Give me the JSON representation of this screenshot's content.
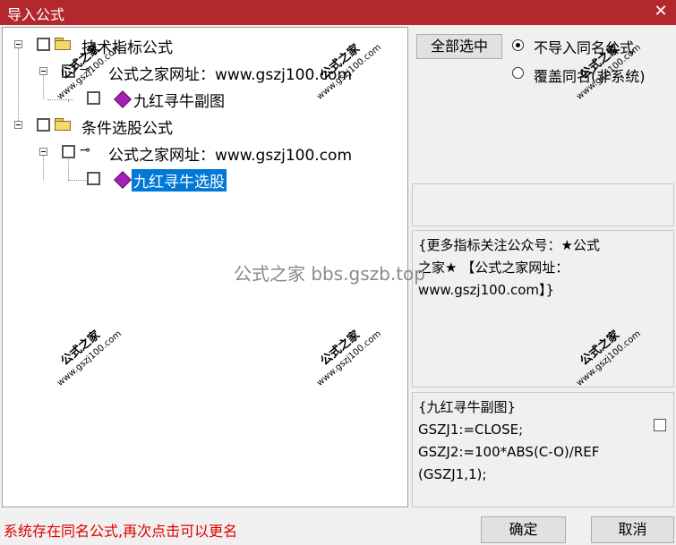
{
  "window": {
    "title": "导入公式",
    "close_glyph": "✕"
  },
  "tree": {
    "nodes": [
      {
        "label": "技术指标公式"
      },
      {
        "label": "公式之家网址：www.gszj100.com"
      },
      {
        "label": "九红寻牛副图"
      },
      {
        "label": "条件选股公式"
      },
      {
        "label": "公式之家网址：www.gszj100.com"
      },
      {
        "label": "九红寻牛选股",
        "selected": true
      }
    ]
  },
  "controls": {
    "select_all_label": "全部选中",
    "radio_options": [
      {
        "label": "不导入同名公式",
        "checked": true
      },
      {
        "label": "覆盖同名(非系统)",
        "checked": false
      }
    ]
  },
  "info_panel": {
    "lines": [
      "{更多指标关注公众号：★公式",
      "之家★ 【公式之家网址：",
      "www.gszj100.com】}"
    ]
  },
  "code_panel": {
    "lines": [
      "{九红寻牛副图}",
      "GSZJ1:=CLOSE;",
      "GSZJ2:=100*ABS(C-O)/REF",
      "(GSZJ1,1);"
    ]
  },
  "status_message": "系统存在同名公式,再次点击可以更名",
  "buttons": {
    "ok": "确定",
    "cancel": "取消"
  },
  "watermark": {
    "brand": "公式之家",
    "url": "www.gszj100.com",
    "center_text": "公式之家 bbs.gszb.top"
  }
}
